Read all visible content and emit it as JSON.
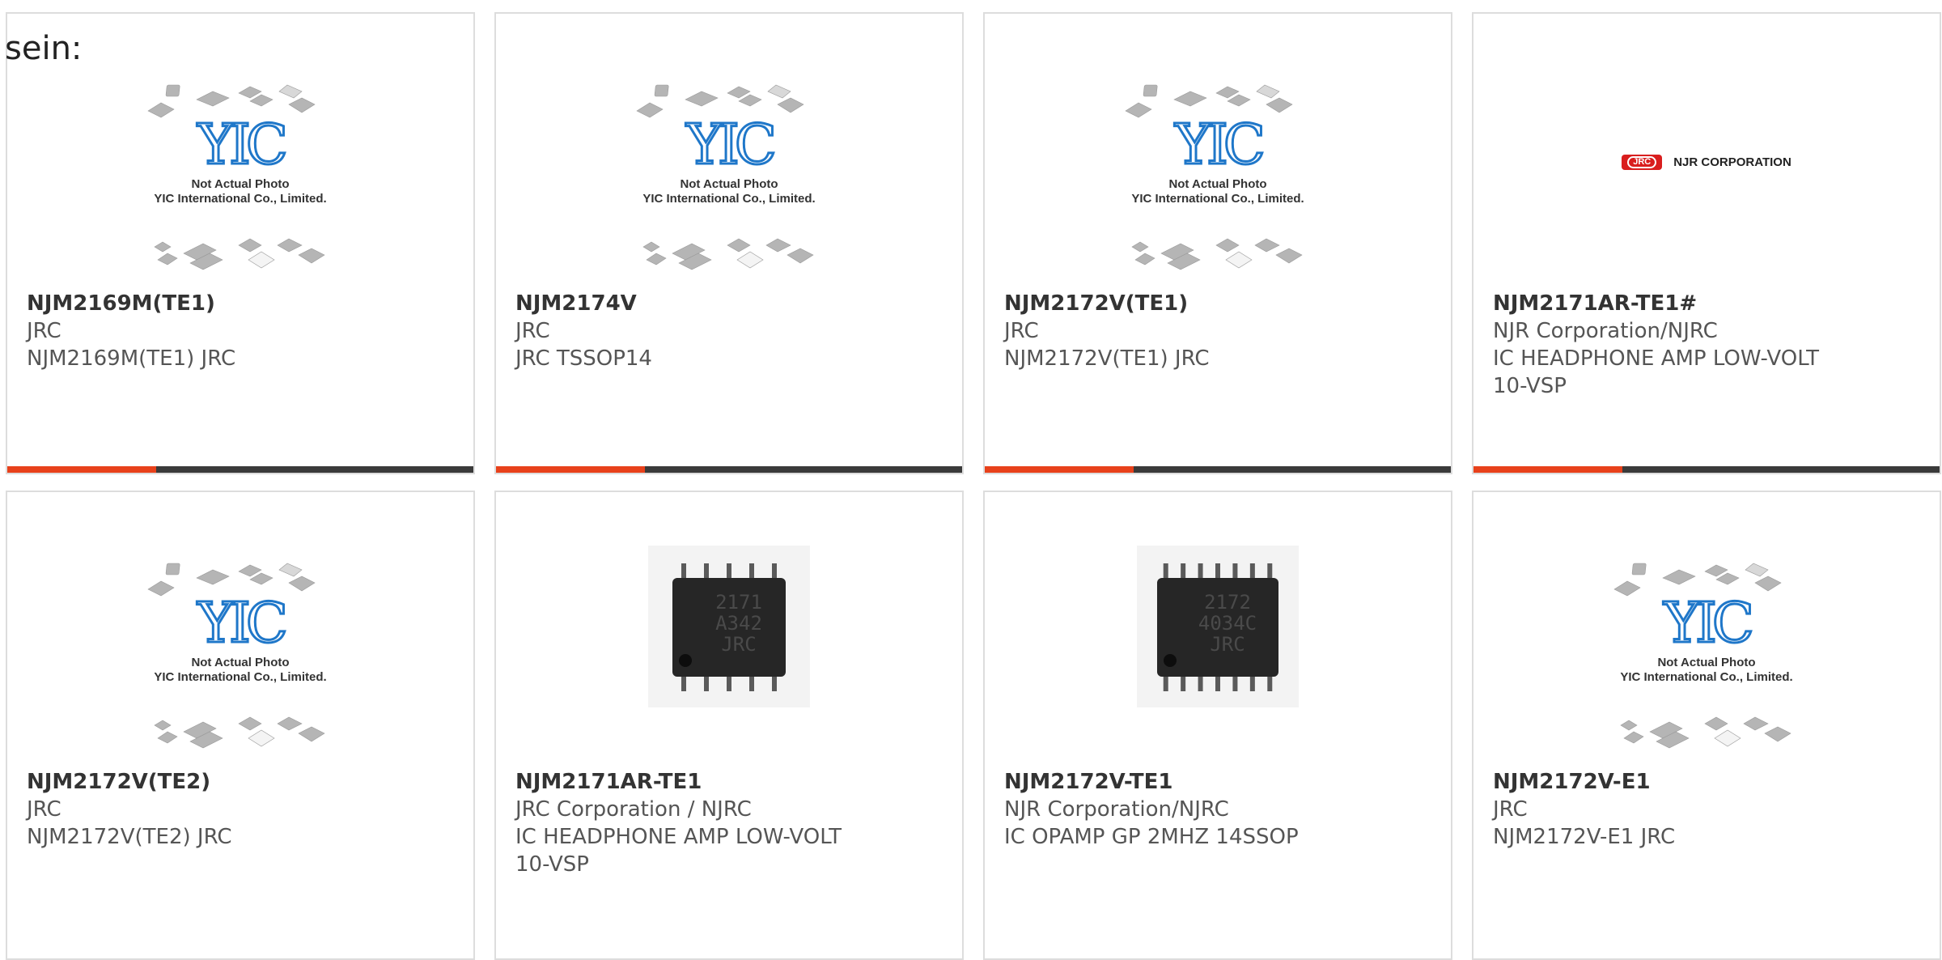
{
  "lead_text": "sein:",
  "placeholder": {
    "line1": "Not Actual Photo",
    "line2": "YIC International Co., Limited.",
    "logo": "YIC"
  },
  "logo_njr": {
    "badge": "JRC",
    "text": "NJR CORPORATION"
  },
  "products": [
    {
      "part": "NJM2169M(TE1)",
      "maker": "JRC",
      "desc1": "NJM2169M(TE1) JRC",
      "desc2": "",
      "image": "placeholder"
    },
    {
      "part": "NJM2174V",
      "maker": "JRC",
      "desc1": "JRC TSSOP14",
      "desc2": "",
      "image": "placeholder"
    },
    {
      "part": "NJM2172V(TE1)",
      "maker": "JRC",
      "desc1": "NJM2172V(TE1) JRC",
      "desc2": "",
      "image": "placeholder"
    },
    {
      "part": "NJM2171AR-TE1#",
      "maker": "NJR Corporation/NJRC",
      "desc1": "IC HEADPHONE AMP LOW-VOLT",
      "desc2": "10-VSP",
      "image": "njr-logo"
    },
    {
      "part": "NJM2172V(TE2)",
      "maker": "JRC",
      "desc1": "NJM2172V(TE2) JRC",
      "desc2": "",
      "image": "placeholder"
    },
    {
      "part": "NJM2171AR-TE1",
      "maker": "JRC Corporation / NJRC",
      "desc1": "IC HEADPHONE AMP LOW-VOLT",
      "desc2": "10-VSP",
      "image": "chip-10pin",
      "chip_marking": [
        "2171",
        "A342",
        "JRC"
      ]
    },
    {
      "part": "NJM2172V-TE1",
      "maker": "NJR Corporation/NJRC",
      "desc1": "IC OPAMP GP 2MHZ 14SSOP",
      "desc2": "",
      "image": "chip-14pin",
      "chip_marking": [
        "2172",
        "4034C",
        "JRC"
      ]
    },
    {
      "part": "NJM2172V-E1",
      "maker": "JRC",
      "desc1": "NJM2172V-E1 JRC",
      "desc2": "",
      "image": "placeholder"
    }
  ],
  "colors": {
    "accent": "#e8411b",
    "bar": "#3a3a3a",
    "yic_blue": "#1f77c9"
  }
}
